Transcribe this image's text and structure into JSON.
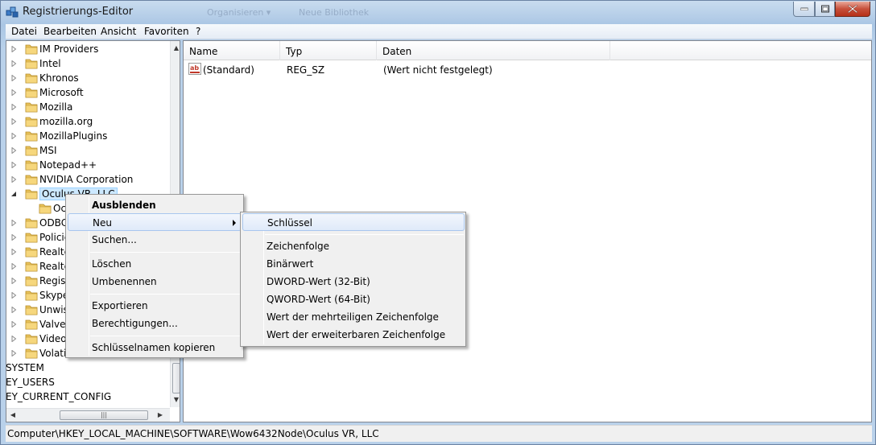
{
  "window": {
    "title": "Registrierungs-Editor",
    "ghost_toolbar": [
      "Organisieren ▾",
      "Neue Bibliothek"
    ]
  },
  "menubar": {
    "items": [
      "Datei",
      "Bearbeiten",
      "Ansicht",
      "Favoriten",
      "?"
    ]
  },
  "tree": {
    "items": [
      {
        "label": "IM Providers",
        "expanded": false
      },
      {
        "label": "Intel",
        "expanded": false
      },
      {
        "label": "Khronos",
        "expanded": false
      },
      {
        "label": "Microsoft",
        "expanded": false
      },
      {
        "label": "Mozilla",
        "expanded": false
      },
      {
        "label": "mozilla.org",
        "expanded": false
      },
      {
        "label": "MozillaPlugins",
        "expanded": false
      },
      {
        "label": "MSI",
        "expanded": false
      },
      {
        "label": "Notepad++",
        "expanded": false
      },
      {
        "label": "NVIDIA Corporation",
        "expanded": false
      },
      {
        "label": "Oculus VR, LLC",
        "expanded": true,
        "selected": true
      },
      {
        "label": "Oculus",
        "indent": true
      },
      {
        "label": "ODBC",
        "expanded": false
      },
      {
        "label": "Policies",
        "expanded": false
      },
      {
        "label": "Realtek",
        "expanded": false
      },
      {
        "label": "Realtek",
        "expanded": false
      },
      {
        "label": "RegisteredApplications",
        "expanded": false
      },
      {
        "label": "Skype",
        "expanded": false
      },
      {
        "label": "Unwise",
        "expanded": false
      },
      {
        "label": "Valve",
        "expanded": false
      },
      {
        "label": "VideoLAN",
        "expanded": false
      },
      {
        "label": "Volatile",
        "expanded": false
      }
    ],
    "roots": [
      "SYSTEM",
      "EY_USERS",
      "EY_CURRENT_CONFIG"
    ]
  },
  "list": {
    "columns": [
      "Name",
      "Typ",
      "Daten"
    ],
    "rows": [
      {
        "name": "(Standard)",
        "type": "REG_SZ",
        "data": "(Wert nicht festgelegt)"
      }
    ]
  },
  "context_menu": {
    "items": [
      "Ausblenden",
      "Neu",
      "Suchen...",
      "Löschen",
      "Umbenennen",
      "Exportieren",
      "Berechtigungen...",
      "Schlüsselnamen kopieren"
    ]
  },
  "submenu": {
    "items": [
      "Schlüssel",
      "Zeichenfolge",
      "Binärwert",
      "DWORD-Wert (32-Bit)",
      "QWORD-Wert (64-Bit)",
      "Wert der mehrteiligen Zeichenfolge",
      "Wert der erweiterbaren Zeichenfolge"
    ]
  },
  "status": {
    "path": "Computer\\HKEY_LOCAL_MACHINE\\SOFTWARE\\Wow6432Node\\Oculus VR, LLC"
  },
  "colors": {
    "folder": "#e8c25a",
    "selection": "#cce8ff",
    "menu_hover": "#dfeafa",
    "close_button": "#c7503b"
  }
}
